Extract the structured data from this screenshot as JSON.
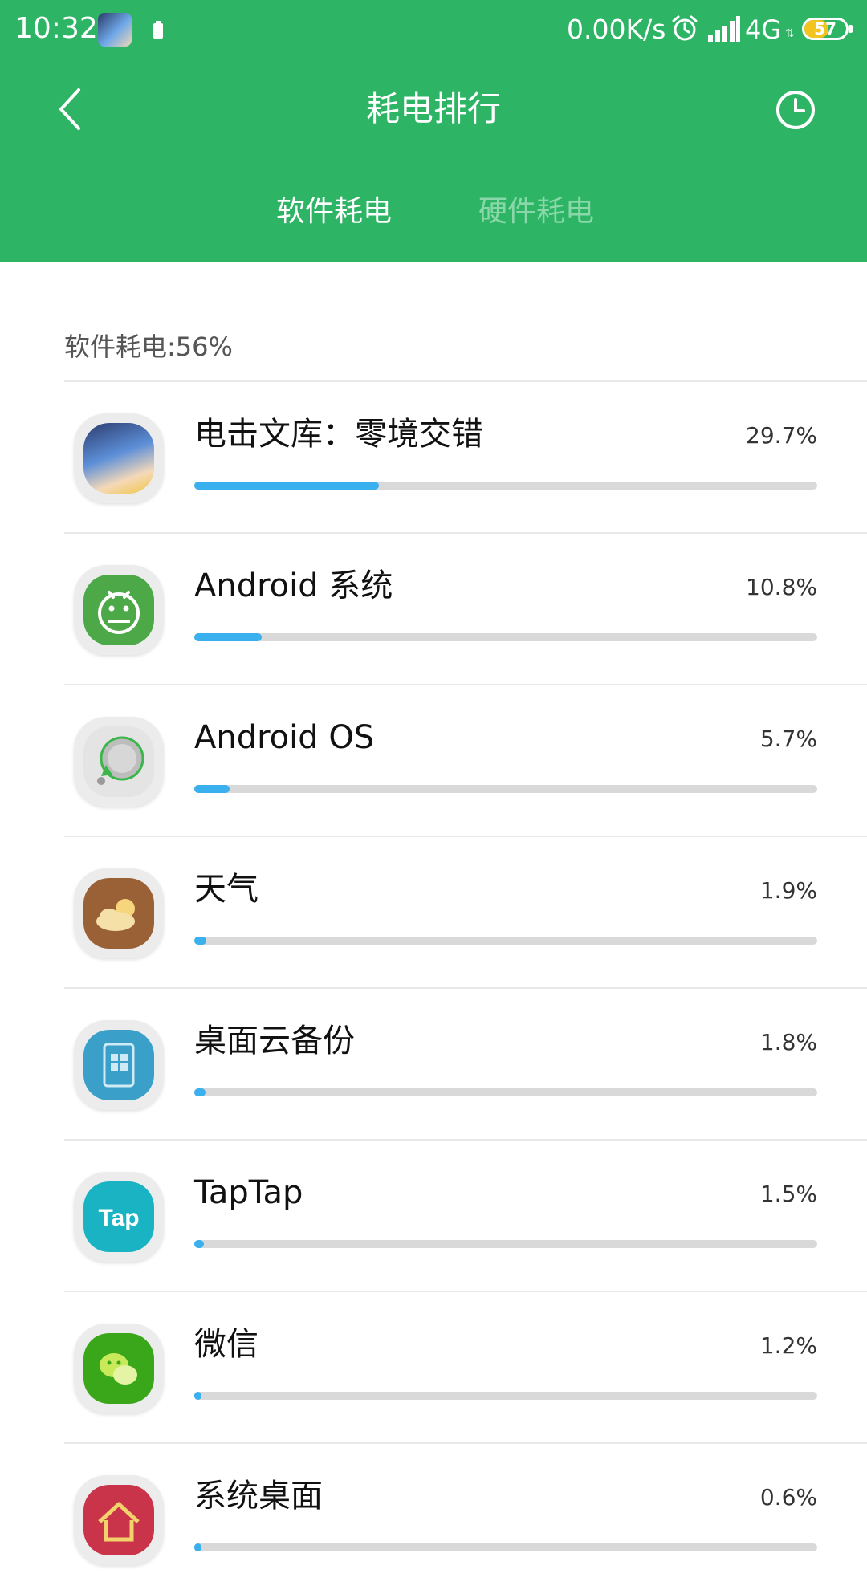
{
  "status_bar": {
    "time": "10:32",
    "speed": "0.00K/s",
    "network": "4G",
    "battery": "57",
    "battery_level": 0.57,
    "icons": [
      "app-avatar-icon",
      "battery-small-icon",
      "alarm-icon",
      "signal-icon",
      "battery-icon"
    ]
  },
  "header": {
    "title": "耗电排行",
    "back_icon": "chevron-left-icon",
    "history_icon": "clock-icon",
    "background": "#2db565"
  },
  "tabs": [
    {
      "label": "软件耗电",
      "active": true
    },
    {
      "label": "硬件耗电",
      "active": false
    }
  ],
  "summary": "软件耗电:56%",
  "apps": [
    {
      "name": "电击文库：零境交错",
      "percent_label": "29.7%",
      "value": 29.7,
      "icon": "game-icon"
    },
    {
      "name": "Android 系统",
      "percent_label": "10.8%",
      "value": 10.8,
      "icon": "android-icon"
    },
    {
      "name": "Android OS",
      "percent_label": "5.7%",
      "value": 5.7,
      "icon": "android-os-icon"
    },
    {
      "name": "天气",
      "percent_label": "1.9%",
      "value": 1.9,
      "icon": "weather-icon"
    },
    {
      "name": "桌面云备份",
      "percent_label": "1.8%",
      "value": 1.8,
      "icon": "cloud-backup-icon"
    },
    {
      "name": "TapTap",
      "percent_label": "1.5%",
      "value": 1.5,
      "icon": "taptap-icon"
    },
    {
      "name": "微信",
      "percent_label": "1.2%",
      "value": 1.2,
      "icon": "wechat-icon"
    },
    {
      "name": "系统桌面",
      "percent_label": "0.6%",
      "value": 0.6,
      "icon": "home-launcher-icon"
    }
  ],
  "colors": {
    "accent_green": "#2db565",
    "bar_fill": "#3ab0ef",
    "bar_track": "#d9d9d9",
    "inactive_tab": "#8ad8aa"
  }
}
